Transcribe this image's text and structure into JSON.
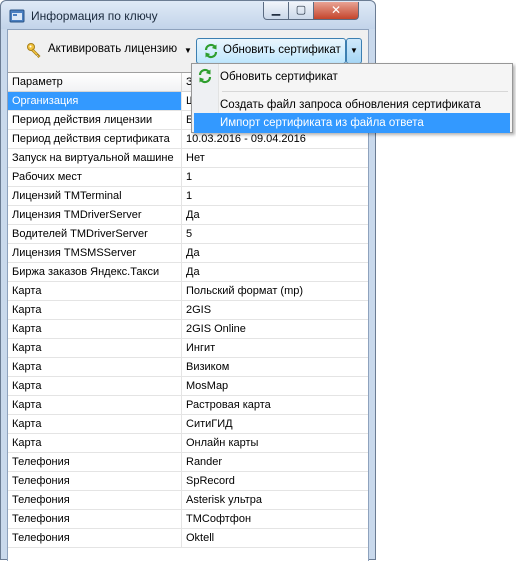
{
  "window": {
    "title": "Информация по ключу",
    "minimize_glyph": "▁",
    "maximize_glyph": "▢",
    "close_glyph": "✕"
  },
  "toolbar": {
    "activate_label": "Активировать лицензию",
    "update_label": "Обновить сертификат",
    "dropdown_glyph": "▼"
  },
  "grid": {
    "columns": [
      "Параметр",
      "З"
    ],
    "rows": [
      {
        "param": "Организация",
        "value": "Ш"
      },
      {
        "param": "Период действия лицензии",
        "value": "Б"
      },
      {
        "param": "Период действия сертификата",
        "value": "10.03.2016 - 09.04.2016"
      },
      {
        "param": "Запуск на виртуальной машине",
        "value": "Нет"
      },
      {
        "param": "Рабочих мест",
        "value": "1"
      },
      {
        "param": "Лицензий TMTerminal",
        "value": "1"
      },
      {
        "param": "Лицензия TMDriverServer",
        "value": "Да"
      },
      {
        "param": "Водителей TMDriverServer",
        "value": "5"
      },
      {
        "param": "Лицензия TMSMSServer",
        "value": "Да"
      },
      {
        "param": "Биржа заказов Яндекс.Такси",
        "value": "Да"
      },
      {
        "param": "Карта",
        "value": "Польский формат (mp)"
      },
      {
        "param": "Карта",
        "value": "2GIS"
      },
      {
        "param": "Карта",
        "value": "2GIS Online"
      },
      {
        "param": "Карта",
        "value": "Ингит"
      },
      {
        "param": "Карта",
        "value": "Визиком"
      },
      {
        "param": "Карта",
        "value": "MosMap"
      },
      {
        "param": "Карта",
        "value": "Растровая карта"
      },
      {
        "param": "Карта",
        "value": "СитиГИД"
      },
      {
        "param": "Карта",
        "value": "Онлайн карты"
      },
      {
        "param": "Телефония",
        "value": "Rander"
      },
      {
        "param": "Телефония",
        "value": "SpRecord"
      },
      {
        "param": "Телефония",
        "value": "Asterisk ультра"
      },
      {
        "param": "Телефония",
        "value": "ТМСофтфон"
      },
      {
        "param": "Телефония",
        "value": "Oktell"
      }
    ]
  },
  "menu": {
    "items": [
      "Обновить сертификат",
      "Создать файл запроса обновления сертификата",
      "Импорт сертификата из файла ответа"
    ]
  },
  "colors": {
    "selection": "#3399ff",
    "button_hover_border": "#3c7fb1"
  },
  "icons": {
    "title": "app-window-icon",
    "activate": "key-icon",
    "update": "refresh-icon"
  }
}
